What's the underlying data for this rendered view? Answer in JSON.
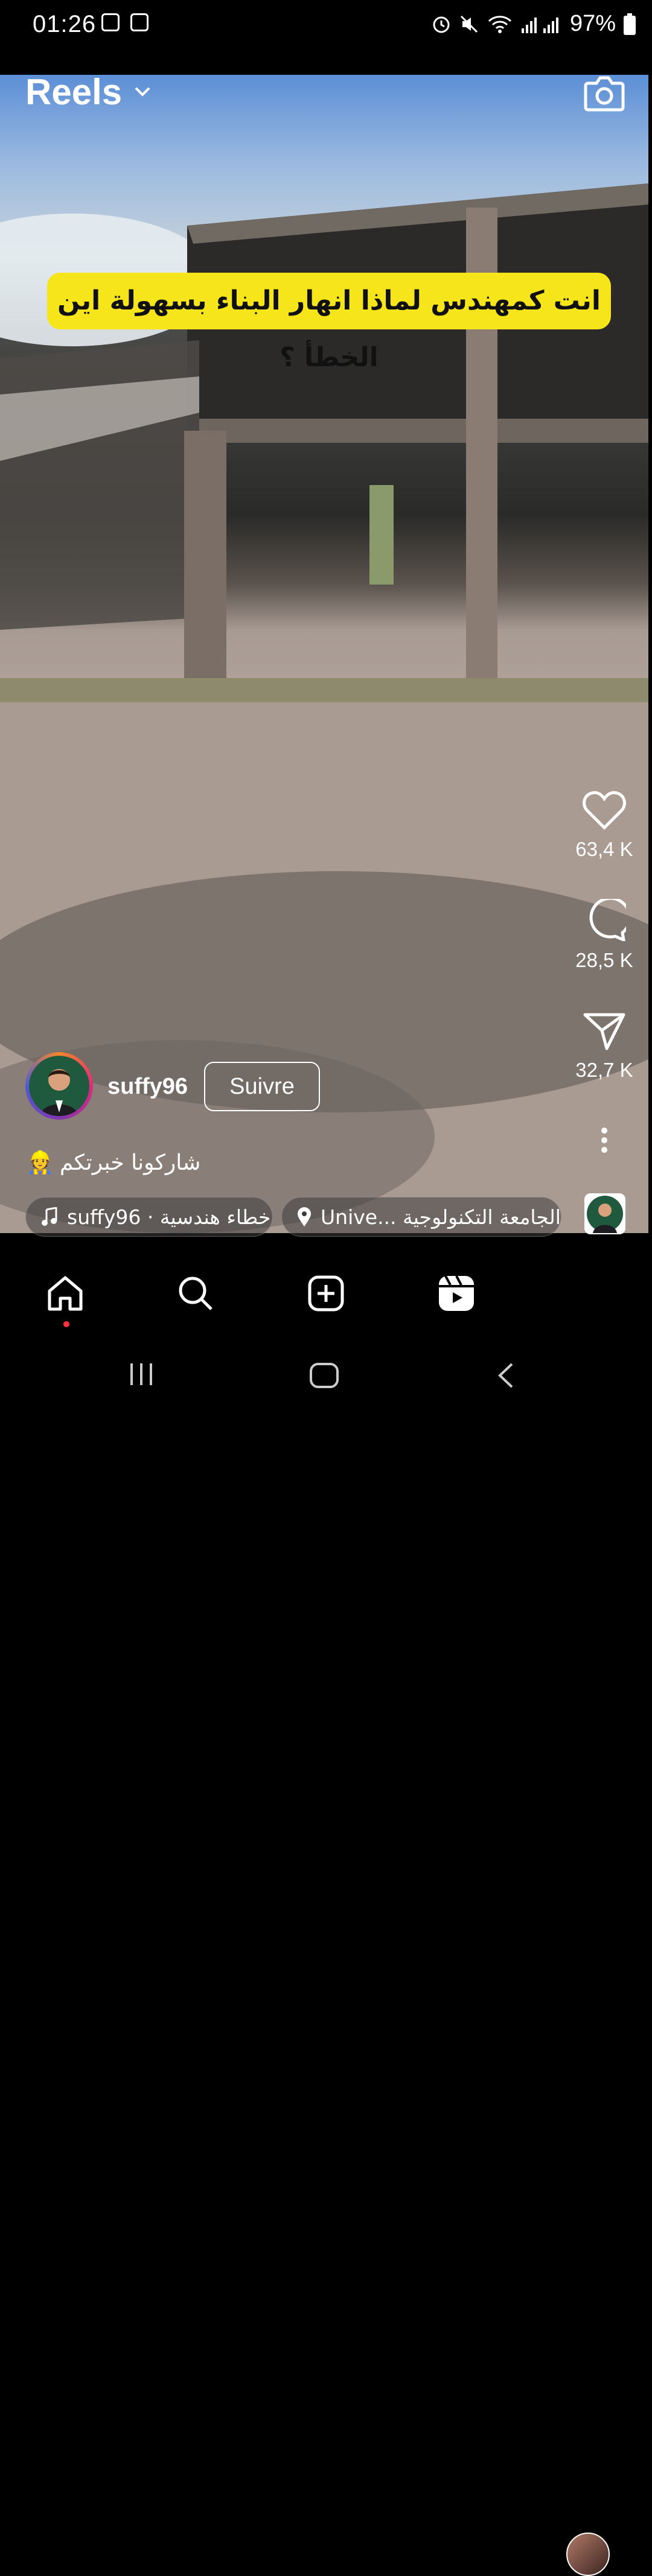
{
  "status_bar": {
    "time": "01:26",
    "battery": "97%"
  },
  "header": {
    "title": "Reels"
  },
  "video": {
    "caption_overlay": "انت كمهندس لماذا انهار البناء بسهولة اين الخطأ ؟"
  },
  "actions": {
    "likes": "63,4 K",
    "comments": "28,5 K",
    "shares": "32,7 K"
  },
  "author": {
    "username": "suffy96",
    "follow_label": "Suivre"
  },
  "post": {
    "caption": "شاركونا خبرتكم",
    "caption_emoji": "👷",
    "audio_label": "suffy96 · أخطاء هندسية",
    "location_label": "Unive... الجامعة التكنولوجية"
  },
  "colors": {
    "banner": "#f7e51c",
    "notification_dot": "#ff3040"
  }
}
